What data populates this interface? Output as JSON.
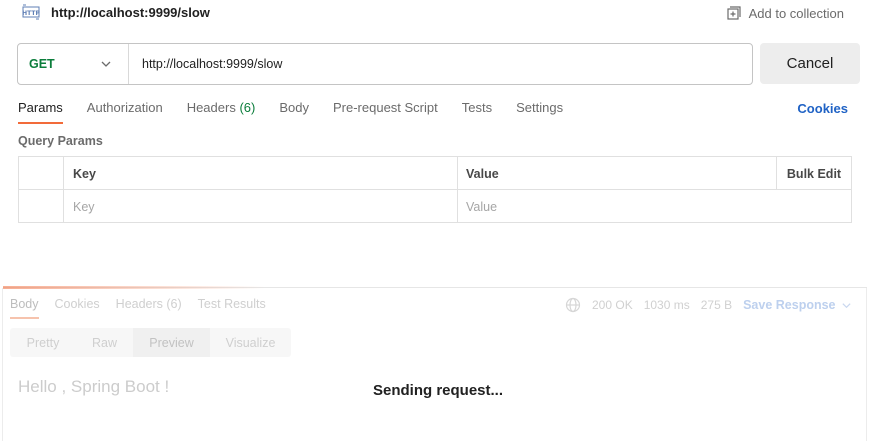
{
  "request": {
    "title": "http://localhost:9999/slow",
    "add_to_collection": "Add to collection",
    "method": "GET",
    "url": "http://localhost:9999/slow",
    "cancel_label": "Cancel"
  },
  "request_tabs": [
    {
      "label": "Params",
      "active": true
    },
    {
      "label": "Authorization"
    },
    {
      "label": "Headers",
      "count": "(6)"
    },
    {
      "label": "Body"
    },
    {
      "label": "Pre-request Script"
    },
    {
      "label": "Tests"
    },
    {
      "label": "Settings"
    }
  ],
  "cookies_label": "Cookies",
  "query_params": {
    "title": "Query Params",
    "columns": {
      "key": "Key",
      "value": "Value",
      "bulk_edit": "Bulk Edit"
    },
    "empty_row": {
      "key_placeholder": "Key",
      "value_placeholder": "Value"
    }
  },
  "response": {
    "tabs": [
      {
        "label": "Body",
        "active": true
      },
      {
        "label": "Cookies"
      },
      {
        "label": "Headers (6)"
      },
      {
        "label": "Test Results"
      }
    ],
    "status": "200 OK",
    "time": "1030 ms",
    "size": "275 B",
    "save_label": "Save Response",
    "view_modes": [
      "Pretty",
      "Raw",
      "Preview",
      "Visualize"
    ],
    "active_view": "Preview",
    "body_text": "Hello , Spring Boot !",
    "sending_label": "Sending request..."
  },
  "colors": {
    "accent": "#f26b3a",
    "method_get": "#0b7d3b",
    "link": "#1f62c5"
  }
}
